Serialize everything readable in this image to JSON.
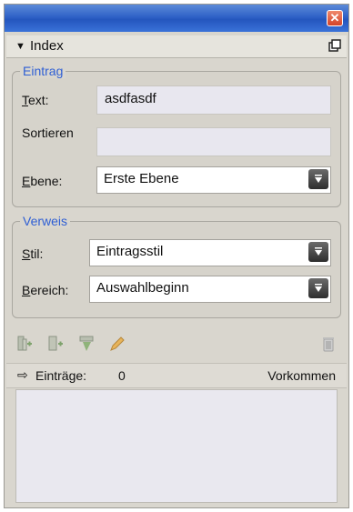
{
  "window": {
    "close_glyph": "✕"
  },
  "panel": {
    "title": "Index",
    "collapse_glyph": "▼"
  },
  "eintrag": {
    "legend": "Eintrag",
    "text_label_u": "T",
    "text_label_rest": "ext:",
    "text_value": "asdfasdf",
    "sort_label": "Sortieren",
    "sort_value": "",
    "level_label_u": "E",
    "level_label_rest": "bene:",
    "level_value": "Erste Ebene"
  },
  "verweis": {
    "legend": "Verweis",
    "style_label_u": "S",
    "style_label_rest": "til:",
    "style_value": "Eintragsstil",
    "range_label_u": "B",
    "range_label_rest": "ereich:",
    "range_value": "Auswahlbeginn"
  },
  "toolbar": {
    "icons": [
      "add-entry-icon",
      "add-reference-icon",
      "generate-index-icon",
      "edit-pencil-icon",
      "trash-icon"
    ]
  },
  "status": {
    "arrow_glyph": "⇨",
    "entries_label": "Einträge:",
    "entries_count": "0",
    "occurrences_label": "Vorkommen"
  },
  "colors": {
    "accent_blue": "#2f5fd4",
    "title_bar": "#2f62c7",
    "close_red": "#d2432a"
  }
}
